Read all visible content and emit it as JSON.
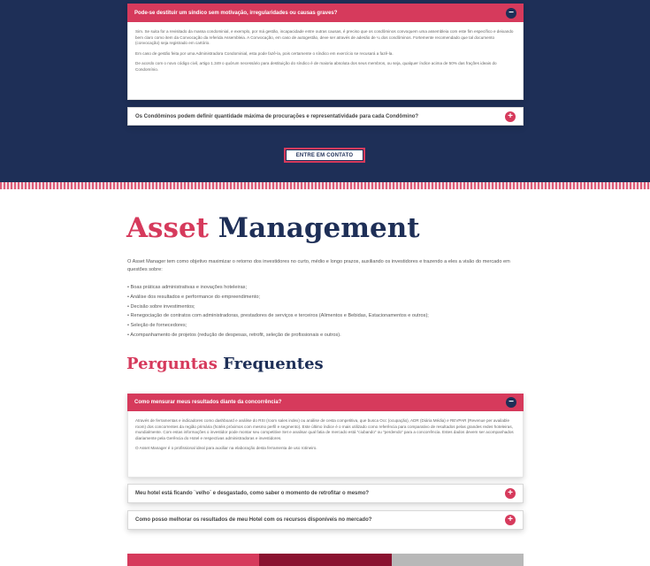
{
  "top_faq": {
    "q1": {
      "title": "Pode-se destituir um síndico sem motivação, irregularidades ou causas graves?",
      "p1": "Sim. Se suita for a revisitado da massa condominial, e exemplo, por má gestão, incapacidade entre outras causas, é preciso que os condôminos convoquem uma assembleia com este fim específico e deixando bem claro como item da Convocação da referida Assembleia. A Convocação, em caso de autogestão, deve ser através de adesão de ¼ dos condôminos. Fortemente recomendado que tal documento (convocação) seja registrado em cartório.",
      "p2": "Em caso de gestão feita por uma Administradora Condominial, esta pode fazê-la, pois certamente o síndico em exercício se recusará a fazê-la.",
      "p3": "De acordo com o novo código civil, artigo 1.349 o quórum necessário para destituição do síndico é de maioria absoluta dos seus membros, ou seja, qualquer índice acima de 50% das frações ideais do Condomínio."
    },
    "q2": {
      "title": "Os Condôminos podem definir quantidade máxima de procurações e representatividade para cada Condômino?"
    },
    "cta_label": "ENTRE EM CONTATO"
  },
  "asset": {
    "heading_light": "Asset",
    "heading_bold": "Management",
    "intro": "O Asset Manager tem como objetivo maximizar o retorno dos investidores no curto, médio e longo prazos, auxiliando os investidores e trazendo a eles a visão do mercado em questões sobre:",
    "bullets": [
      "Boas práticas administrativas e inovações hoteleiras;",
      "Análise dos resultados e performance do empreendimento;",
      "Decisão sobre investimentos;",
      "Renegociação de contratos com administradoras, prestadores de serviços e terceiros (Alimentos e Bebidas, Estacionamentos e outros);",
      "Seleção de fornecedores;",
      "Acompanhamento de projetos (redução de despesas, retrofit, seleção de profissionais e outros)."
    ]
  },
  "faq": {
    "heading_light": "Perguntas",
    "heading_bold": "Frequentes",
    "items": [
      {
        "title": "Como mensurar meus resultados diante da concorrência?",
        "p1": "Através de ferramentas e indicadores como dashboard e análise do RSI (room sales index) ou análise de cesta competitiva, que busca Occ (ocupação), ADR (Diária Média) e REVPAR (Revenue per available room) dos concorrentes da região primária (hotéis próximos com mesmo perfil e segmento). Este último índice é o mais utilizado como referência para comparativo de resultados pelas grandes redes hoteleiras, mundialmente. Com estas informações o investidor pode montar seu competitive Set e analisar qual fatia de mercado está “ciubando” ou “perdendo” para a concorrência. Estes dados devem ser acompanhados diariamente pela Gerência do Hotel e respectivas administradoras e investidores.",
        "p2": "O Asset Manager é o profissional ideal para auxiliar na elaboração desta ferramenta de uso rotineiro."
      },
      {
        "title": "Meu hotel está ficando ¨velho¨ e desgastado, como saber o momento de retrofitar o mesmo?"
      },
      {
        "title": "Como posso melhorar os resultados de meu Hotel com os recursos disponíveis no mercado?"
      }
    ]
  },
  "icons": {
    "collapse": "−",
    "expand": "+"
  },
  "colors": {
    "navy": "#1e2f57",
    "accent": "#d63a5c",
    "maroon": "#8a1230",
    "gray": "#b8b8b8"
  }
}
